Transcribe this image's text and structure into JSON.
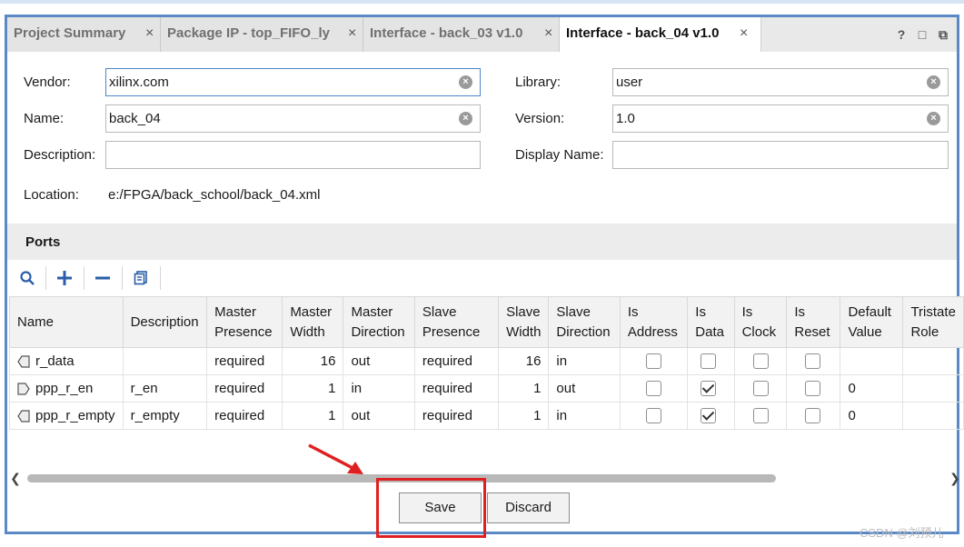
{
  "tabs": [
    {
      "label": "Project Summary",
      "close": "×"
    },
    {
      "label": "Package IP - top_FIFO_ly",
      "close": "×"
    },
    {
      "label": "Interface - back_03 v1.0",
      "close": "×"
    },
    {
      "label": "Interface - back_04 v1.0",
      "close": "×"
    }
  ],
  "tab_icons": {
    "help": "?",
    "restore": "□",
    "float": "⧉"
  },
  "form": {
    "vendor_label": "Vendor:",
    "vendor_value": "xilinx.com",
    "name_label": "Name:",
    "name_value": "back_04",
    "description_label": "Description:",
    "description_value": "",
    "library_label": "Library:",
    "library_value": "user",
    "version_label": "Version:",
    "version_value": "1.0",
    "display_name_label": "Display Name:",
    "display_name_value": "",
    "location_label": "Location:",
    "location_value": "e:/FPGA/back_school/back_04.xml"
  },
  "ports": {
    "title": "Ports",
    "headers": [
      "Name",
      "Description",
      "Master\nPresence",
      "Master\nWidth",
      "Master\nDirection",
      "Slave\nPresence",
      "Slave\nWidth",
      "Slave\nDirection",
      "Is\nAddress",
      "Is\nData",
      "Is\nClock",
      "Is\nReset",
      "Default\nValue",
      "Tristate\nRole"
    ],
    "rows": [
      {
        "name": "r_data",
        "direction_icon": "port-in-icon",
        "description": "",
        "master_presence": "required",
        "master_width": "16",
        "master_direction": "out",
        "slave_presence": "required",
        "slave_width": "16",
        "slave_direction": "in",
        "is_address": false,
        "is_data": false,
        "is_clock": false,
        "is_reset": false,
        "default_value": "",
        "tristate_role": ""
      },
      {
        "name": "ppp_r_en",
        "direction_icon": "port-out-icon",
        "description": "r_en",
        "master_presence": "required",
        "master_width": "1",
        "master_direction": "in",
        "slave_presence": "required",
        "slave_width": "1",
        "slave_direction": "out",
        "is_address": false,
        "is_data": true,
        "is_clock": false,
        "is_reset": false,
        "default_value": "0",
        "tristate_role": ""
      },
      {
        "name": "ppp_r_empty",
        "direction_icon": "port-in-icon",
        "description": "r_empty",
        "master_presence": "required",
        "master_width": "1",
        "master_direction": "out",
        "slave_presence": "required",
        "slave_width": "1",
        "slave_direction": "in",
        "is_address": false,
        "is_data": true,
        "is_clock": false,
        "is_reset": false,
        "default_value": "0",
        "tristate_role": ""
      }
    ]
  },
  "buttons": {
    "save": "Save",
    "discard": "Discard"
  },
  "colors": {
    "frame": "#5a89c6",
    "highlight": "#e02020",
    "toolbar_icon": "#2a5ea8"
  },
  "watermark": "CSDN @刘预儿"
}
